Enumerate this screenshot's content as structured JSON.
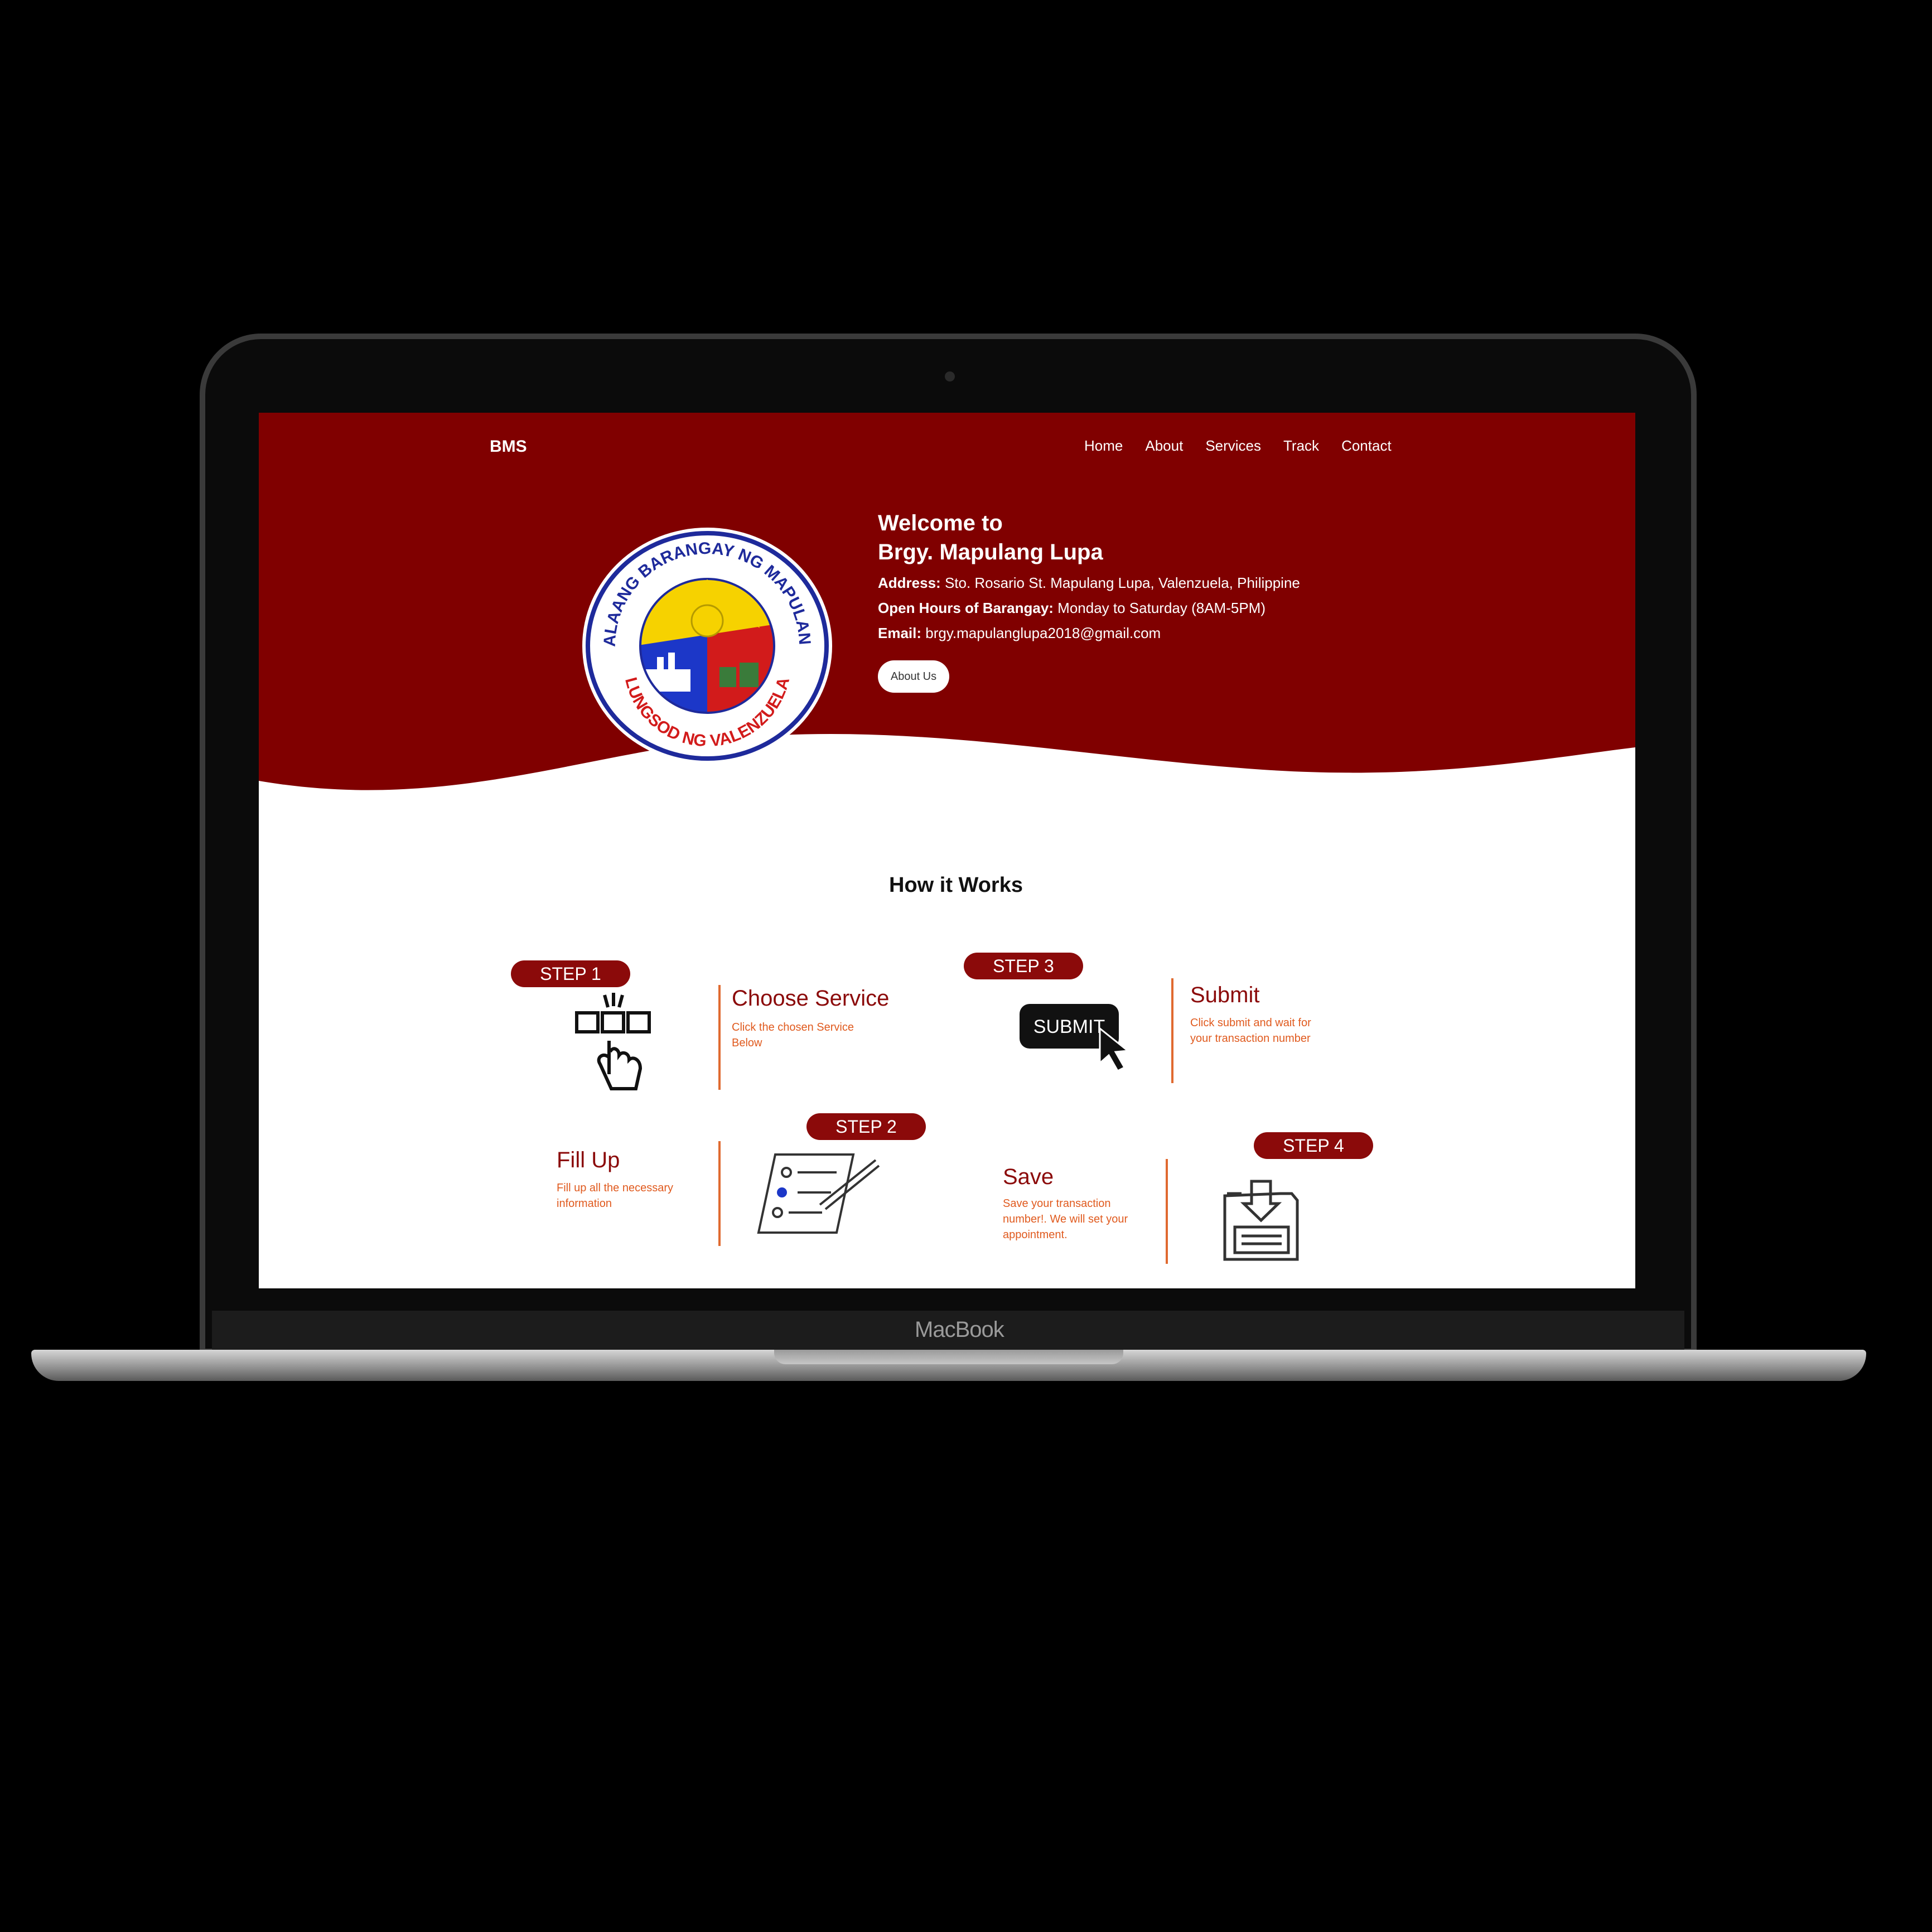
{
  "nav": {
    "logo": "BMS",
    "items": [
      "Home",
      "About",
      "Services",
      "Track",
      "Contact"
    ]
  },
  "hero": {
    "title_line1": "Welcome to",
    "title_line2": "Brgy. Mapulang Lupa",
    "address_label": "Address:",
    "address": "Sto. Rosario St. Mapulang Lupa, Valenzuela, Philippine",
    "hours_label": "Open Hours of Barangay:",
    "hours": "Monday to Saturday (8AM-5PM)",
    "email_label": "Email:",
    "email": "brgy.mapulanglupa2018@gmail.com",
    "button": "About Us",
    "seal_text_top": "PAMAHALAANG BARANGAY NG MAPULANG LUPA",
    "seal_text_bottom": "LUNGSOD NG VALENZUELA"
  },
  "how": {
    "title": "How it Works",
    "steps": [
      {
        "pill": "STEP 1",
        "title": "Choose Service",
        "desc": "Click the chosen Service Below",
        "icon": "hand-pointer-boxes-icon"
      },
      {
        "pill": "STEP 2",
        "title": "Fill Up",
        "desc": "Fill up all the necessary information",
        "icon": "form-pen-icon"
      },
      {
        "pill": "STEP 3",
        "title": "Submit",
        "desc": "Click submit and wait for your transaction number",
        "icon": "submit-button-cursor-icon",
        "icon_text": "SUBMIT"
      },
      {
        "pill": "STEP 4",
        "title": "Save",
        "desc": "Save your transaction number!. We will set your appointment.",
        "icon": "save-download-icon"
      }
    ]
  },
  "device": {
    "brand": "MacBook"
  },
  "colors": {
    "primary": "#800000",
    "pill": "#8b0a0a",
    "accent": "#e06a30"
  }
}
